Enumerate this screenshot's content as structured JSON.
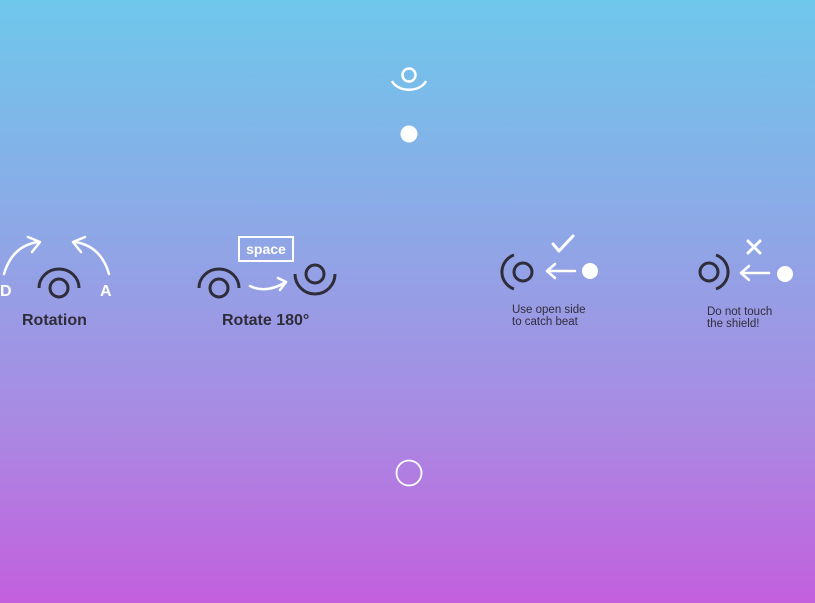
{
  "game": {
    "background_top": "#6ec8ec",
    "background_bottom": "#c35fdd",
    "ink_color": "#2f2d3a",
    "light_color": "#ffffff"
  },
  "tutorial": {
    "rotation": {
      "label": "Rotation",
      "left_key": "D",
      "right_key": "A",
      "icons": [
        "curved-arrow-left-icon",
        "curved-arrow-right-icon",
        "shielded-player-icon"
      ]
    },
    "rotate180": {
      "label": "Rotate 180°",
      "key": "space",
      "icons": [
        "shielded-player-icon",
        "arrow-right-icon",
        "flipped-player-icon"
      ]
    },
    "catch": {
      "line1": "Use open side",
      "line2": "to catch beat",
      "icons": [
        "check-icon",
        "arrow-left-icon",
        "beat-dot-icon",
        "open-side-player-icon"
      ]
    },
    "avoid": {
      "line1": "Do not touch",
      "line2": "the shield!",
      "icons": [
        "cross-icon",
        "arrow-left-icon",
        "beat-dot-icon",
        "shield-side-player-icon"
      ]
    }
  }
}
